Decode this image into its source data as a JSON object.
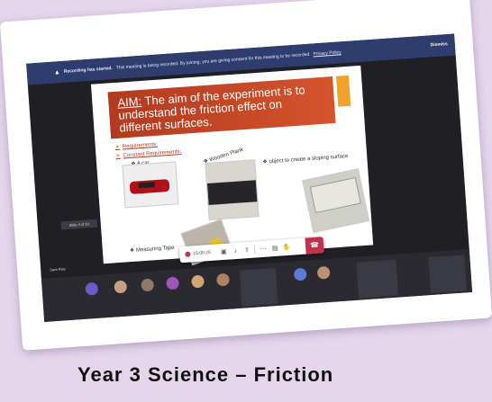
{
  "banner": {
    "title": "Recording has started.",
    "text": "This meeting is being recorded. By joining, you are giving consent for this meeting to be recorded.",
    "link": "Privacy Policy",
    "dismiss": "Dismiss"
  },
  "slide": {
    "aim_label": "AIM:",
    "aim_text": "The aim of the experiment is to understand the friction effect on different surfaces.",
    "requirements": "Requirements:",
    "constant": "Constant Requirements:",
    "items": {
      "car": "A car",
      "plank": "Wooden Plank",
      "object": "object to create a sloping surface",
      "tape": "Measuring Tape"
    },
    "pager": "Slide 4 of 10"
  },
  "participant": {
    "name": "Sara Riaz"
  },
  "toolbar": {
    "timer": "15:00:25"
  },
  "caption": "Year 3 Science – Friction"
}
